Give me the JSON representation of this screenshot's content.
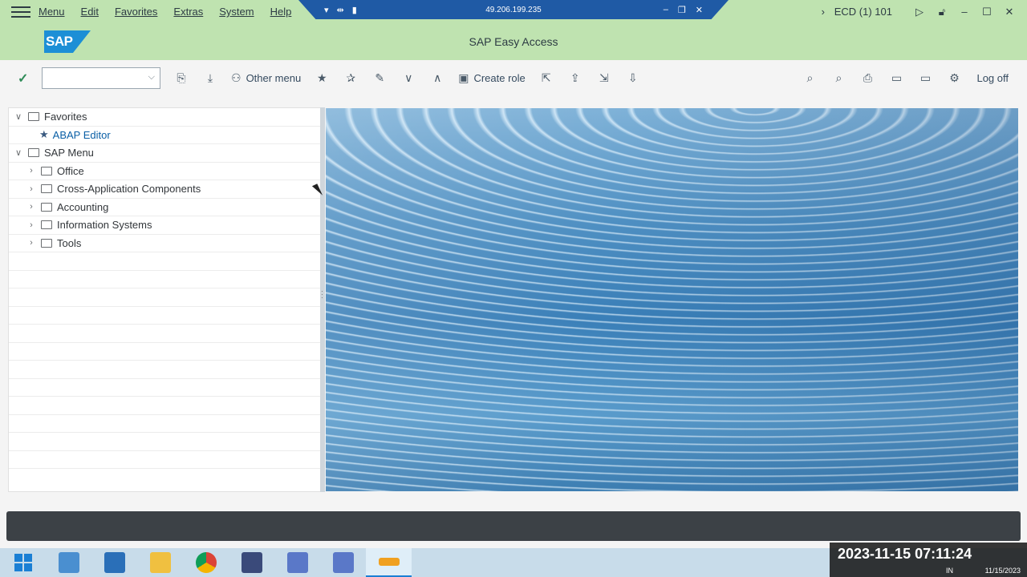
{
  "menubar": {
    "items": [
      {
        "label": "Menu"
      },
      {
        "label": "Edit"
      },
      {
        "label": "Favorites"
      },
      {
        "label": "Extras"
      },
      {
        "label": "System"
      },
      {
        "label": "Help"
      }
    ]
  },
  "rdp": {
    "address": "49.206.199.235",
    "left_icons": [
      "pin-icon",
      "move-icon",
      "signal-icon"
    ],
    "right_icons": [
      "minimize-icon",
      "restore-icon",
      "close-icon"
    ]
  },
  "system": {
    "system_id": "ECD (1) 101"
  },
  "title": "SAP Easy Access",
  "logo_text": "SAP",
  "toolbar": {
    "command_value": "",
    "other_menu": "Other menu",
    "create_role": "Create role",
    "log_off": "Log off"
  },
  "tree": [
    {
      "label": "Favorites",
      "level": 0,
      "type": "folder",
      "expanded": true
    },
    {
      "label": "ABAP Editor",
      "level": 1,
      "type": "favorite"
    },
    {
      "label": "SAP Menu",
      "level": 0,
      "type": "folder",
      "expanded": true
    },
    {
      "label": "Office",
      "level": 1,
      "type": "folder",
      "expanded": false
    },
    {
      "label": "Cross-Application Components",
      "level": 1,
      "type": "folder",
      "expanded": false
    },
    {
      "label": "Accounting",
      "level": 1,
      "type": "folder",
      "expanded": false
    },
    {
      "label": "Information Systems",
      "level": 1,
      "type": "folder",
      "expanded": false
    },
    {
      "label": "Tools",
      "level": 1,
      "type": "folder",
      "expanded": false
    }
  ],
  "clock": {
    "timestamp": "2023-11-15  07:11:24",
    "date": "11/15/2023",
    "lang": "IN"
  },
  "colors": {
    "header_green": "#bfe3b0",
    "sap_blue": "#1c8fd6",
    "taskbar": "#c8dcea"
  }
}
